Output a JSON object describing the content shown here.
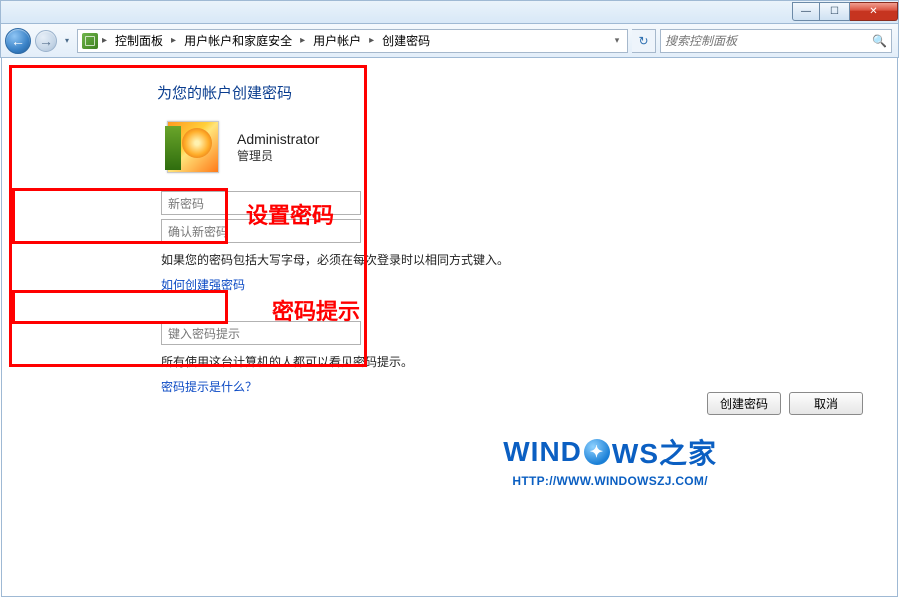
{
  "titlebar": {
    "min_glyph": "—",
    "max_glyph": "☐",
    "close_glyph": "✕"
  },
  "nav": {
    "back_glyph": "←",
    "fwd_glyph": "→",
    "dropdown_glyph": "▾",
    "refresh_glyph": "↻"
  },
  "breadcrumb": {
    "sep": "▸",
    "items": [
      "控制面板",
      "用户帐户和家庭安全",
      "用户帐户",
      "创建密码"
    ]
  },
  "search": {
    "placeholder": "搜索控制面板",
    "icon": "🔍"
  },
  "page": {
    "title": "为您的帐户创建密码",
    "account_name": "Administrator",
    "account_role": "管理员",
    "new_password_placeholder": "新密码",
    "confirm_password_placeholder": "确认新密码",
    "caps_note": "如果您的密码包括大写字母，必须在每次登录时以相同方式键入。",
    "strong_pw_link": "如何创建强密码",
    "hint_placeholder": "键入密码提示",
    "hint_note": "所有使用这台计算机的人都可以看见密码提示。",
    "hint_link": "密码提示是什么？",
    "create_btn": "创建密码",
    "cancel_btn": "取消"
  },
  "annotations": {
    "set_password": "设置密码",
    "password_hint": "密码提示"
  },
  "watermark": {
    "text_left": "WIND",
    "text_right": "WS之家",
    "url": "HTTP://WWW.WINDOWSZJ.COM/"
  }
}
